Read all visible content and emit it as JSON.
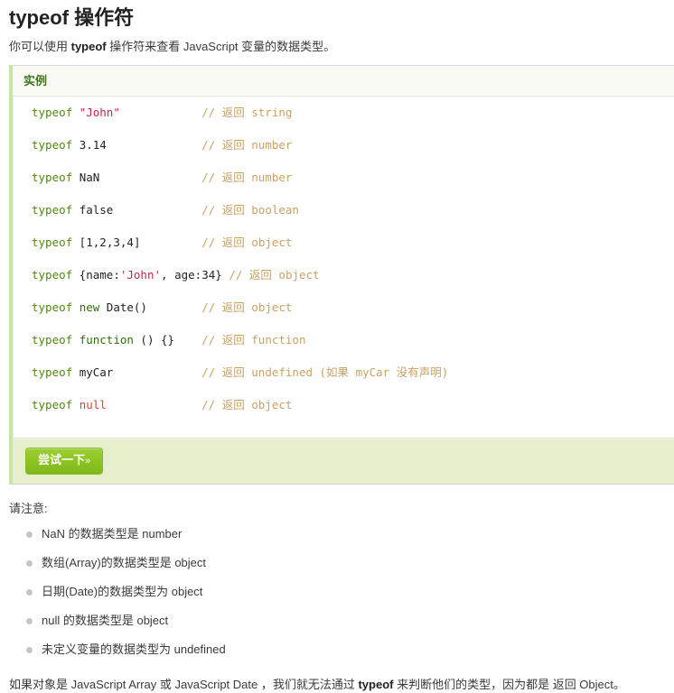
{
  "page": {
    "title": "typeof 操作符",
    "intro_before": "你可以使用 ",
    "intro_keyword": "typeof",
    "intro_after": " 操作符来查看 JavaScript 变量的数据类型。"
  },
  "example": {
    "header_label": "实例",
    "button_label": "尝试一下",
    "button_arrow": "»",
    "code_lines": [
      {
        "keyword": "typeof",
        "expr": " \"John\"",
        "comment": "// 返回 string"
      },
      {
        "keyword": "typeof",
        "expr": " 3.14",
        "comment": "// 返回 number"
      },
      {
        "keyword": "typeof",
        "expr": " NaN",
        "comment": "// 返回 number"
      },
      {
        "keyword": "typeof",
        "expr": " false",
        "comment": "// 返回 boolean"
      },
      {
        "keyword": "typeof",
        "expr": " [1,2,3,4]",
        "comment": "// 返回 object"
      },
      {
        "keyword": "typeof",
        "expr": " {name:'John', age:34}",
        "comment": "// 返回 object"
      },
      {
        "keyword": "typeof",
        "expr": " new Date()",
        "comment": "// 返回 object"
      },
      {
        "keyword": "typeof",
        "expr": " function () {}",
        "comment": "// 返回 function"
      },
      {
        "keyword": "typeof",
        "expr": " myCar",
        "comment": "// 返回 undefined (如果 myCar 没有声明)"
      },
      {
        "keyword": "typeof",
        "expr": " null",
        "comment": "// 返回 object"
      }
    ]
  },
  "notes": {
    "title": "请注意:",
    "items": [
      "NaN 的数据类型是 number",
      "数组(Array)的数据类型是 object",
      "日期(Date)的数据类型为 object",
      "null 的数据类型是 object",
      "未定义变量的数据类型为 undefined"
    ]
  },
  "closing": {
    "before": "如果对象是 JavaScript Array 或 JavaScript Date ，我们就无法通过 ",
    "keyword": "typeof",
    "after": " 来判断他们的类型，因为都是 返回 Object。"
  },
  "colors": {
    "accent_green": "#7fb81c",
    "header_green": "#3f7420",
    "footer_bg": "#e6eecc",
    "border_green": "#c8e6a0",
    "comment": "#c8a165",
    "string": "#c7254e",
    "null": "#d14836"
  }
}
